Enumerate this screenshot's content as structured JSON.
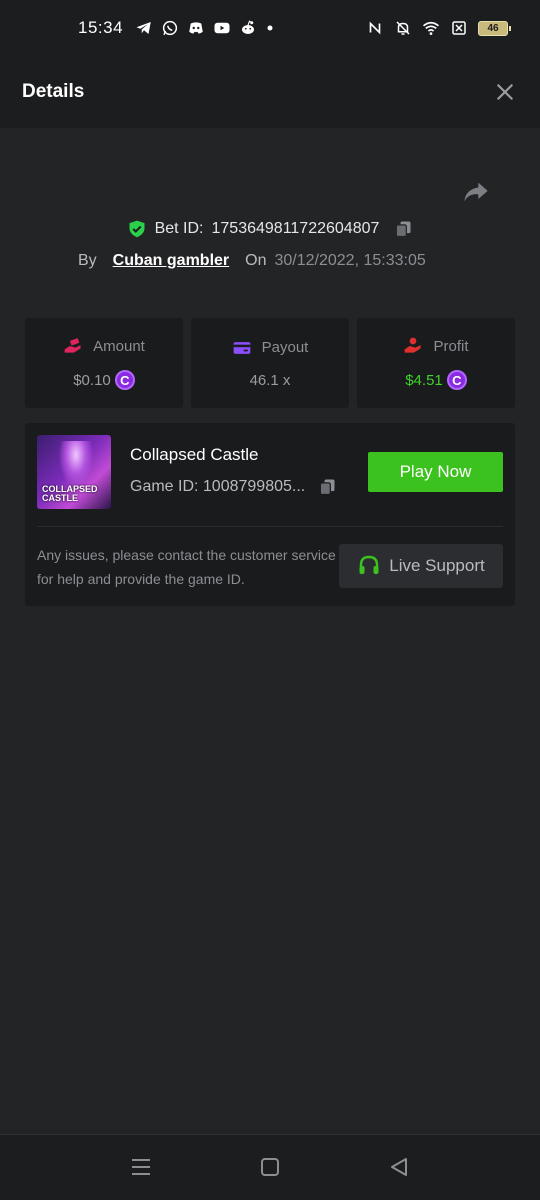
{
  "status_bar": {
    "time": "15:34",
    "battery": "46",
    "app_icons": [
      "telegram-icon",
      "whatsapp-icon",
      "discord-icon",
      "youtube-icon",
      "reddit-icon",
      "dot-icon"
    ],
    "system_icons": [
      "nfc-icon",
      "bell-off-icon",
      "wifi-icon",
      "sim-off-icon",
      "battery-icon"
    ]
  },
  "header": {
    "title": "Details"
  },
  "bet": {
    "id_label": "Bet ID:",
    "id_value": "1753649811722604807",
    "by_label": "By",
    "user": "Cuban gambler",
    "on_label": "On",
    "datetime": "30/12/2022, 15:33:05"
  },
  "stats": {
    "amount": {
      "label": "Amount",
      "value": "$0.10",
      "icon_color": "#e0245e"
    },
    "payout": {
      "label": "Payout",
      "value": "46.1 x",
      "icon_color": "#8a4dff"
    },
    "profit": {
      "label": "Profit",
      "value": "$4.51",
      "icon_color": "#e0302f",
      "value_color": "#3fd12a"
    }
  },
  "coin_symbol": "C",
  "game": {
    "name": "Collapsed Castle",
    "id_text": "Game ID: 1008799805...",
    "thumb_text_1": "COLLAPSED",
    "thumb_text_2": "CASTLE",
    "play_label": "Play Now",
    "help_text": "Any issues, please contact the customer service for help and provide the game ID.",
    "support_label": "Live Support"
  },
  "colors": {
    "accent_green": "#3cc21f",
    "background": "#232426",
    "card": "#1a1b1d"
  }
}
